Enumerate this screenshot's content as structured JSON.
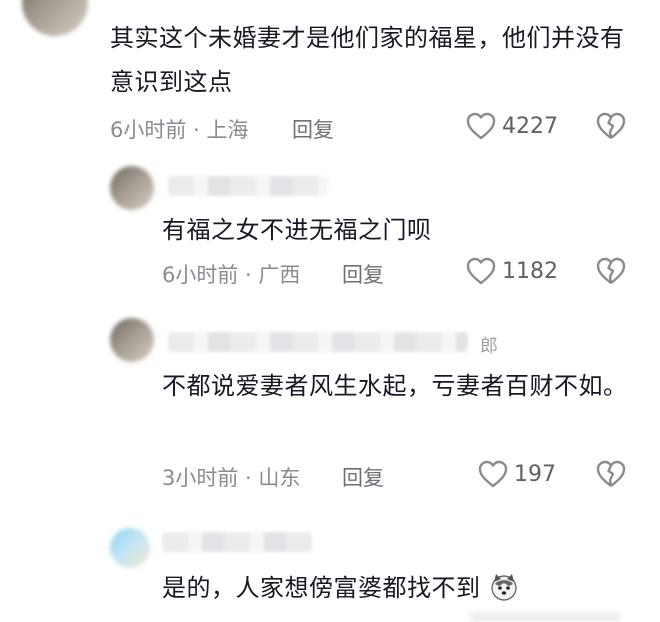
{
  "comments": [
    {
      "name_tail": "",
      "text": "其实这个未婚妻才是他们家的福星，他们并没有意识到这点",
      "time": "6小时前",
      "location": "上海",
      "reply_label": "回复",
      "likes": "4227"
    },
    {
      "name_tail": "",
      "text": "有福之女不进无福之门呗",
      "time": "6小时前",
      "location": "广西",
      "reply_label": "回复",
      "likes": "1182"
    },
    {
      "name_tail": "郎",
      "text": "不都说爱妻者风生水起，亏妻者百财不如。",
      "time": "3小时前",
      "location": "山东",
      "reply_label": "回复",
      "likes": "197"
    },
    {
      "name_tail": "",
      "text": "是的，人家想傍富婆都找不到",
      "emoji": "husky-emoji"
    }
  ],
  "meta_separator": " · ",
  "colors": {
    "text": "#161823",
    "meta": "#8a8b91",
    "icon": "#8a8b91"
  },
  "icons": {
    "like": "heart-outline-icon",
    "dislike": "broken-heart-icon"
  }
}
